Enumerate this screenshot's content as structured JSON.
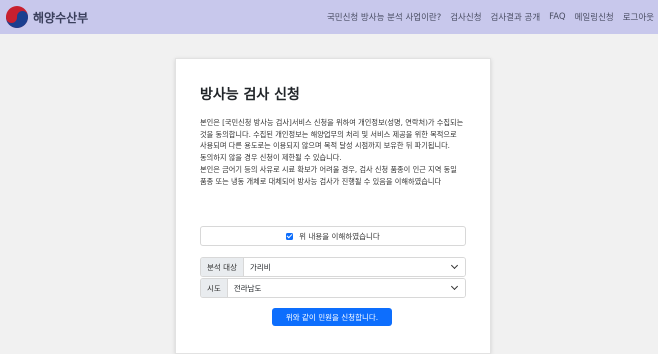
{
  "header": {
    "brand": "해양수산부",
    "nav": [
      "국민신청 방사능 분석 사업이란?",
      "검사신청",
      "검사결과 공개",
      "FAQ",
      "메일링신청",
      "로그아웃"
    ]
  },
  "form": {
    "title": "방사능 검사 신청",
    "consent_paragraphs": [
      "본인은 [국민신청 방사능 검사]서비스 신청을 위하여 개인정보(성명, 연락처)가 수집되는 것을 동의합니다. 수집된 개인정보는 해양업무의 처리 및 서비스 제공을 위한 목적으로 사용되며 다른 용도로는 이용되지 않으며 목적 달성 시점까지 보유한 뒤 파기됩니다. 동의하지 않을 경우 신청이 제한될 수 있습니다.",
      "본인은 금어기 등의 사유로 시료 확보가 어려울 경우, 검사 신청 품종이 인근 지역 동일 품종 또는 냉동 개체로 대체되어 방사능 검사가 진행될 수 있음을 이해하였습니다"
    ],
    "agree_label": "위 내용을 이해하였습니다",
    "agree_checked": true,
    "target_label": "분석 대상",
    "target_value": "가리비",
    "region_label": "시도",
    "region_value": "전라남도",
    "submit_label": "위와 같이 민원을 신청합니다."
  }
}
